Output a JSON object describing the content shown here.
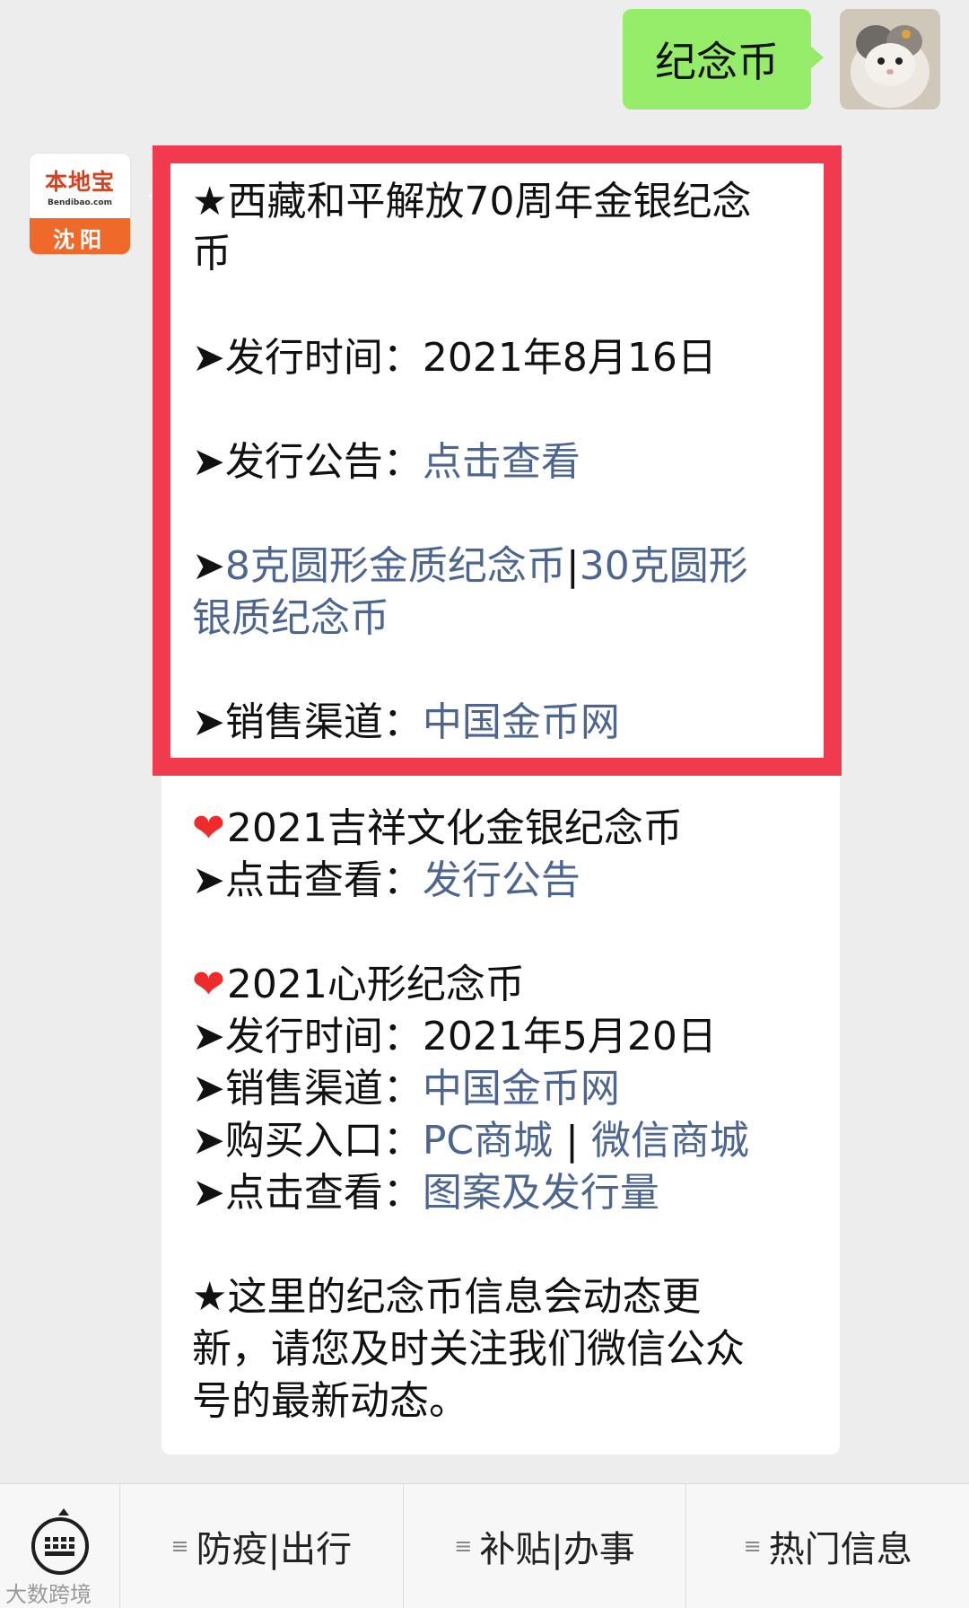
{
  "user_message": {
    "text": "纪念币"
  },
  "bot": {
    "brand": "本地宝",
    "domain": "Bendibao.com",
    "city": "沈阳"
  },
  "message": {
    "title_line1": "★西藏和平解放70周年金银纪念",
    "title_line2": "币",
    "issue_date_label": "➤发行时间：",
    "issue_date": "2021年8月16日",
    "notice_label": "➤发行公告：",
    "notice_link": "点击查看",
    "coin_arrow": "➤",
    "coin_link1": "8克圆形金质纪念币",
    "coin_sep": "|",
    "coin_link2": "30克圆形",
    "coin_link2_cont": "银质纪念币",
    "channel_label": "➤销售渠道：",
    "channel_link": "中国金币网",
    "lucky_title": "2021吉祥文化金银纪念币",
    "lucky_view_label": "➤点击查看：",
    "lucky_view_link": "发行公告",
    "heart_title": "2021心形纪念币",
    "heart_date_label": "➤发行时间：",
    "heart_date": "2021年5月20日",
    "heart_channel_label": "➤销售渠道：",
    "heart_channel_link": "中国金币网",
    "heart_buy_label": "➤购买入口：",
    "heart_buy_pc": "PC商城",
    "heart_buy_sep": " | ",
    "heart_buy_wx": "微信商城",
    "heart_view_label": "➤点击查看：",
    "heart_view_link": "图案及发行量",
    "footer_line1": "★这里的纪念币信息会动态更",
    "footer_line2": "新，请您及时关注我们微信公众",
    "footer_line3": "号的最新动态。"
  },
  "menu": {
    "items": [
      {
        "label": "防疫|出行"
      },
      {
        "label": "补贴|办事"
      },
      {
        "label": "热门信息"
      }
    ]
  },
  "watermark": "大数跨境",
  "colors": {
    "user_bubble": "#95ec69",
    "link": "#4d6690",
    "highlight": "#f23a4f"
  }
}
